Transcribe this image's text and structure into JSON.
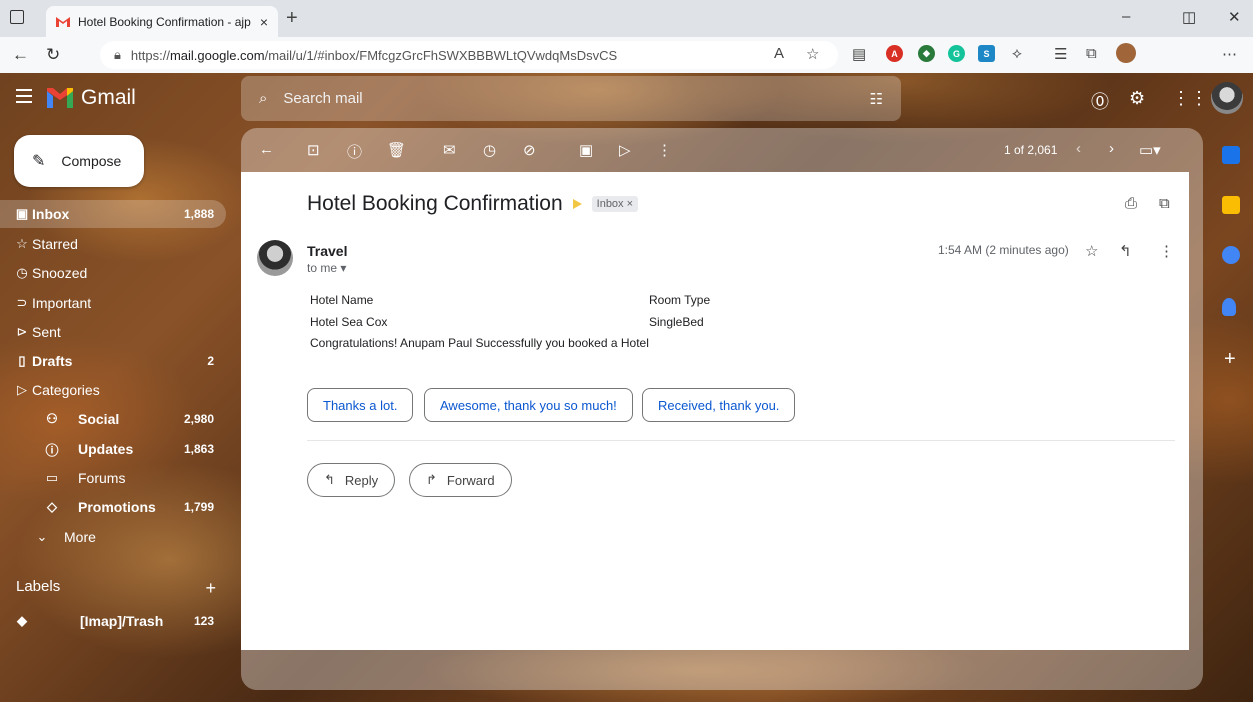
{
  "browser": {
    "tab_title": "Hotel Booking Confirmation - ajp",
    "tab_close": "×",
    "new_tab": "+",
    "url_prefix": "https://",
    "url_domain": "mail.google.com",
    "url_path": "/mail/u/1/#inbox/FMfcgzGrcFhSWXBBBWLtQVwdqMsDsvCS",
    "window_controls": {
      "minimize": "–",
      "restore": "◫",
      "close": "✕"
    }
  },
  "gmail": {
    "app_name": "Gmail",
    "search_placeholder": "Search mail",
    "compose_label": "Compose"
  },
  "sidebar": {
    "items": [
      {
        "label": "Inbox",
        "count": "1,888",
        "icon": "inbox-icon",
        "glyph": "▣",
        "bold": true,
        "active": true
      },
      {
        "label": "Starred",
        "count": "",
        "icon": "star-icon",
        "glyph": "☆"
      },
      {
        "label": "Snoozed",
        "count": "",
        "icon": "clock-icon",
        "glyph": "◷"
      },
      {
        "label": "Important",
        "count": "",
        "icon": "important-icon",
        "glyph": "⊃"
      },
      {
        "label": "Sent",
        "count": "",
        "icon": "send-icon",
        "glyph": "⊳"
      },
      {
        "label": "Drafts",
        "count": "2",
        "icon": "draft-icon",
        "glyph": "▯",
        "bold": true
      },
      {
        "label": "Categories",
        "count": "",
        "icon": "label-icon",
        "glyph": "▷"
      }
    ],
    "categories": [
      {
        "label": "Social",
        "count": "2,980",
        "icon": "people-icon",
        "glyph": "⚇",
        "bold": true
      },
      {
        "label": "Updates",
        "count": "1,863",
        "icon": "info-icon",
        "glyph": "ⓘ",
        "bold": true
      },
      {
        "label": "Forums",
        "count": "",
        "icon": "forum-icon",
        "glyph": "▭"
      },
      {
        "label": "Promotions",
        "count": "1,799",
        "icon": "tag-icon",
        "glyph": "◇",
        "bold": true
      }
    ],
    "more_label": "More",
    "labels_header": "Labels",
    "labels_add": "+",
    "labels": [
      {
        "label": "[Imap]/Trash",
        "count": "123"
      }
    ]
  },
  "toolbar": {
    "paging": "1 of 2,061"
  },
  "message": {
    "subject": "Hotel Booking Confirmation",
    "chip": "Inbox ×",
    "sender": "Travel",
    "to": "to me ▾",
    "time": "1:54 AM (2 minutes ago)",
    "body": {
      "col1_header": "Hotel Name",
      "col2_header": "Room Type",
      "col1_value": "Hotel Sea Cox",
      "col2_value": "SingleBed",
      "note": "Congratulations! Anupam Paul Successfully you booked a Hotel"
    },
    "smart_replies": [
      "Thanks a lot.",
      "Awesome, thank you so much!",
      "Received, thank you."
    ],
    "reply_label": "Reply",
    "forward_label": "Forward"
  },
  "colors": {
    "accent_blue": "#0b57d0",
    "important_yellow": "#f2c744"
  }
}
